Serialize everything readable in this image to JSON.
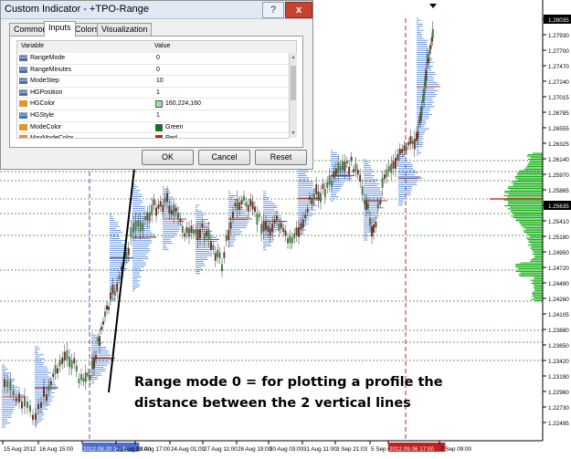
{
  "dialog": {
    "title": "Custom Indicator - +TPO-Range",
    "help": "?",
    "close": "x",
    "tabs": [
      "Common",
      "Inputs",
      "Colors",
      "Visualization"
    ],
    "active_tab": "Inputs",
    "table": {
      "headers": {
        "variable": "Variable",
        "value": "Value"
      },
      "rows": [
        {
          "icon": "number-icon",
          "name": "RangeMode",
          "value": "0"
        },
        {
          "icon": "number-icon",
          "name": "RangeMinutes",
          "value": "0"
        },
        {
          "icon": "number-icon",
          "name": "ModeStep",
          "value": "10"
        },
        {
          "icon": "number-icon",
          "name": "HGPosition",
          "value": "1"
        },
        {
          "icon": "color-icon",
          "name": "HGColor",
          "value": "160,224,160",
          "swatch": "#a0e0a0"
        },
        {
          "icon": "number-icon",
          "name": "HGStyle",
          "value": "1"
        },
        {
          "icon": "color-icon",
          "name": "ModeColor",
          "value": "Green",
          "swatch": "#008000"
        },
        {
          "icon": "color-icon",
          "name": "MaxModeColor",
          "value": "Red",
          "swatch": "#ff0000"
        }
      ]
    },
    "buttons": {
      "ok": "OK",
      "cancel": "Cancel",
      "reset": "Reset"
    }
  },
  "annotation": {
    "line1": "Range mode 0 = for plotting a profile the",
    "line2": "distance between the 2 vertical lines"
  },
  "chart": {
    "price_labels": [
      "1.28035",
      "1.27930",
      "1.27700",
      "1.27470",
      "1.27240",
      "1.27015",
      "1.26785",
      "1.26555",
      "1.26325",
      "1.26140",
      "1.25970",
      "1.25865",
      "1.25635",
      "1.25410",
      "1.25180",
      "1.24950",
      "1.24720",
      "1.24490",
      "1.24260",
      "1.24105",
      "1.23880",
      "1.23650",
      "1.23420",
      "1.23190",
      "1.22960",
      "1.22730",
      "1.22495"
    ],
    "highlighted_prices": {
      "1.28035": "#000000",
      "1.25635": "#000000"
    },
    "time_labels": [
      "15 Aug 2012",
      "16 Aug 15:00",
      "2012.08.20 10:03",
      "21 Aug 09:00",
      "22 Aug 17:00",
      "24 Aug 01:00",
      "27 Aug 11:00",
      "28 Aug 19:00",
      "30 Aug 03:00",
      "31 Aug 11:00",
      "3 Sep 21:03",
      "5 Sep 0",
      "2012.09.06 17:00",
      "7 Sep 09:00"
    ],
    "time_highlight": {
      "2012.08.20 10:03": "#4a6fd0",
      "2012.09.06 17:00": "#c22020"
    },
    "colors": {
      "bull_candle": "#4a7d4a",
      "bear_candle": "#6a3a2a",
      "profile": "#4a7fd6",
      "volume_profile": "#18b018",
      "mode_line": "#c04020"
    }
  }
}
